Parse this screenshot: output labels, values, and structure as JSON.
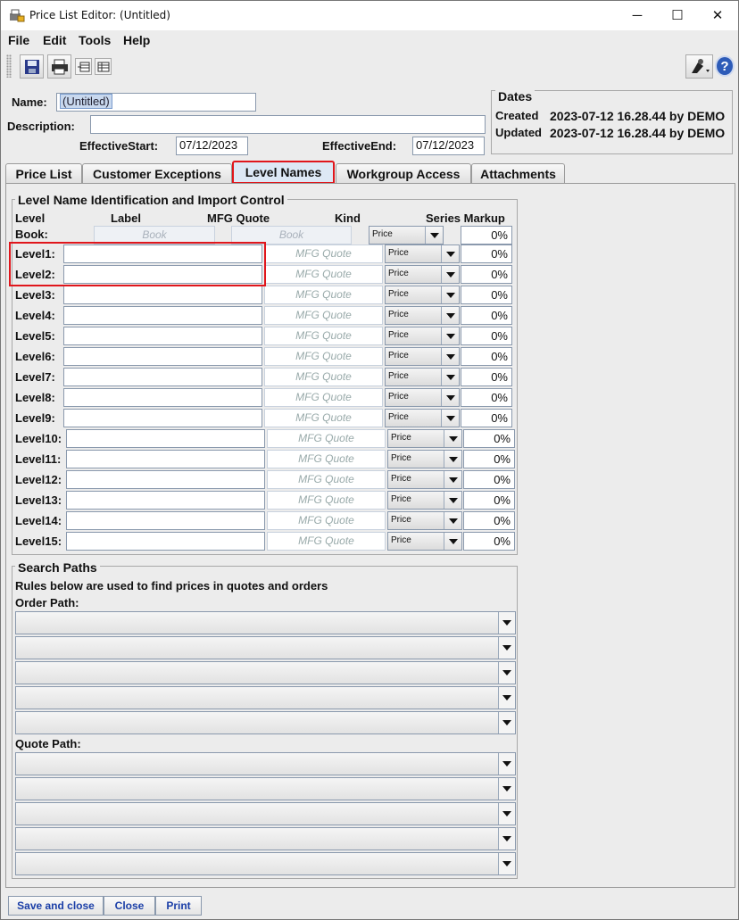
{
  "window": {
    "title": "Price List Editor: (Untitled)",
    "minimize_glyph": "─",
    "maximize_glyph": "☐",
    "close_glyph": "✕"
  },
  "menu": [
    "File",
    "Edit",
    "Tools",
    "Help"
  ],
  "toolbar": {
    "icons": [
      "save-icon",
      "print-icon",
      "export-icon",
      "grid-icon",
      "pick-tool-icon",
      "help-icon"
    ],
    "help_glyph": "?"
  },
  "header": {
    "name_label": "Name:",
    "name_value": "(Untitled)",
    "description_label": "Description:",
    "description_value": "",
    "effective_start_label": "EffectiveStart:",
    "effective_start_value": "07/12/2023",
    "effective_end_label": "EffectiveEnd:",
    "effective_end_value": "07/12/2023"
  },
  "dates": {
    "title": "Dates",
    "created_label": "Created",
    "created_value": "2023-07-12 16.28.44 by DEMO",
    "updated_label": "Updated",
    "updated_value": "2023-07-12 16.28.44 by DEMO"
  },
  "tabs": [
    "Price List",
    "Customer Exceptions",
    "Level Names",
    "Workgroup Access",
    "Attachments"
  ],
  "active_tab": "Level Names",
  "level_names": {
    "group_title": "Level Name Identification and Import Control",
    "col_level": "Level",
    "col_label": "Label",
    "col_mfg_quote": "MFG Quote",
    "col_kind": "Kind",
    "col_series_markup": "Series Markup",
    "book": {
      "label": "Book:",
      "label_placeholder": "Book",
      "mfg_placeholder": "Book",
      "kind": "Price",
      "markup": "0%"
    },
    "mfg_placeholder": "MFG Quote",
    "rows": [
      {
        "label": "Level1:",
        "kind": "Price",
        "markup": "0%"
      },
      {
        "label": "Level2:",
        "kind": "Price",
        "markup": "0%"
      },
      {
        "label": "Level3:",
        "kind": "Price",
        "markup": "0%"
      },
      {
        "label": "Level4:",
        "kind": "Price",
        "markup": "0%"
      },
      {
        "label": "Level5:",
        "kind": "Price",
        "markup": "0%"
      },
      {
        "label": "Level6:",
        "kind": "Price",
        "markup": "0%"
      },
      {
        "label": "Level7:",
        "kind": "Price",
        "markup": "0%"
      },
      {
        "label": "Level8:",
        "kind": "Price",
        "markup": "0%"
      },
      {
        "label": "Level9:",
        "kind": "Price",
        "markup": "0%"
      },
      {
        "label": "Level10:",
        "kind": "Price",
        "markup": "0%"
      },
      {
        "label": "Level11:",
        "kind": "Price",
        "markup": "0%"
      },
      {
        "label": "Level12:",
        "kind": "Price",
        "markup": "0%"
      },
      {
        "label": "Level13:",
        "kind": "Price",
        "markup": "0%"
      },
      {
        "label": "Level14:",
        "kind": "Price",
        "markup": "0%"
      },
      {
        "label": "Level15:",
        "kind": "Price",
        "markup": "0%"
      }
    ]
  },
  "search_paths": {
    "group_title": "Search Paths",
    "description": "Rules below are used to find prices in quotes and orders",
    "order_path_label": "Order Path:",
    "quote_path_label": "Quote Path:"
  },
  "buttons": {
    "save_and_close": "Save and close",
    "close": "Close",
    "print": "Print"
  },
  "colors": {
    "highlight": "#e0161c",
    "button_text": "#1b3fa8",
    "selection": "#c8d8ee"
  }
}
